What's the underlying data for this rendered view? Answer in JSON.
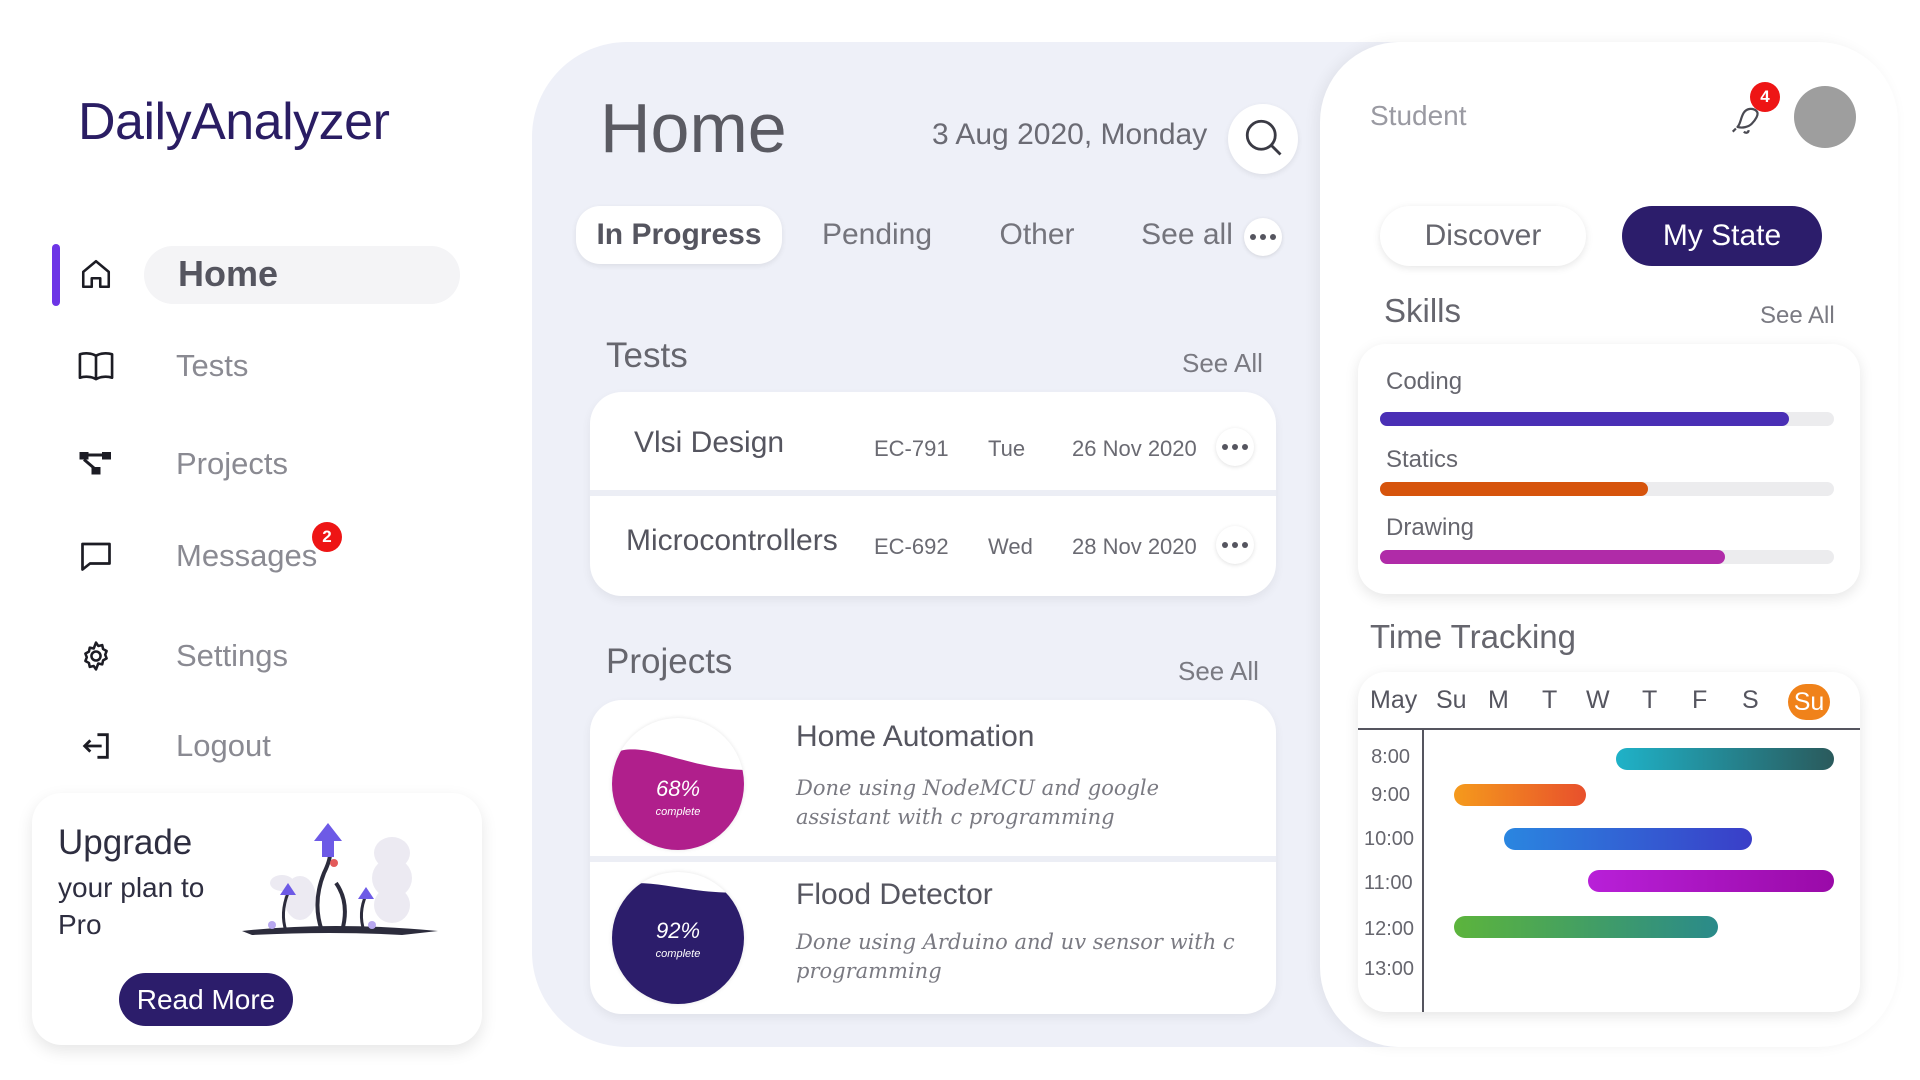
{
  "app": {
    "title": "DailyAnalyzer"
  },
  "sidebar": {
    "items": [
      {
        "label": "Home",
        "icon": "home-icon",
        "active": true
      },
      {
        "label": "Tests",
        "icon": "book-icon"
      },
      {
        "label": "Projects",
        "icon": "network-icon"
      },
      {
        "label": "Messages",
        "icon": "message-icon",
        "badge": "2"
      },
      {
        "label": "Settings",
        "icon": "gear-icon"
      },
      {
        "label": "Logout",
        "icon": "logout-icon"
      }
    ],
    "upgrade": {
      "title": "Upgrade",
      "text": "your plan to Pro",
      "button": "Read More"
    }
  },
  "header": {
    "title": "Home",
    "date": "3 Aug 2020, Monday",
    "search_icon": "search-icon"
  },
  "tabs": [
    {
      "label": "In Progress",
      "active": true
    },
    {
      "label": "Pending"
    },
    {
      "label": "Other"
    },
    {
      "label": "See all"
    }
  ],
  "tests": {
    "title": "Tests",
    "see_all": "See All",
    "rows": [
      {
        "name": "Vlsi Design",
        "code": "EC-791",
        "day": "Tue",
        "date": "26 Nov 2020"
      },
      {
        "name": "Microcontrollers",
        "code": "EC-692",
        "day": "Wed",
        "date": "28 Nov 2020"
      }
    ]
  },
  "projects": {
    "title": "Projects",
    "see_all": "See All",
    "items": [
      {
        "name": "Home Automation",
        "desc": "Done using NodeMCU and google assistant with c programming",
        "percent": "68%",
        "progress": 0.68,
        "status": "complete",
        "color": "#b01f8c"
      },
      {
        "name": "Flood Detector",
        "desc": "Done using Arduino and uv sensor with c programming",
        "percent": "92%",
        "progress": 0.92,
        "status": "complete",
        "color": "#2c1d6b"
      }
    ]
  },
  "right_panel": {
    "role": "Student",
    "notifications": "4",
    "discover": "Discover",
    "my_state": "My State",
    "skills": {
      "title": "Skills",
      "see_all": "See All",
      "items": [
        {
          "label": "Coding",
          "level": 0.9,
          "color": "#4a2fb5"
        },
        {
          "label": "Statics",
          "level": 0.59,
          "color": "#d6540c"
        },
        {
          "label": "Drawing",
          "level": 0.76,
          "color": "#b02ba8"
        }
      ]
    },
    "time_tracking": {
      "title": "Time Tracking",
      "month": "May",
      "days": [
        "Su",
        "M",
        "T",
        "W",
        "T",
        "F",
        "S",
        "Su"
      ],
      "highlight_day": "Su",
      "times": [
        "8:00",
        "9:00",
        "10:00",
        "11:00",
        "12:00",
        "13:00"
      ],
      "accent": "#f0821a"
    }
  }
}
